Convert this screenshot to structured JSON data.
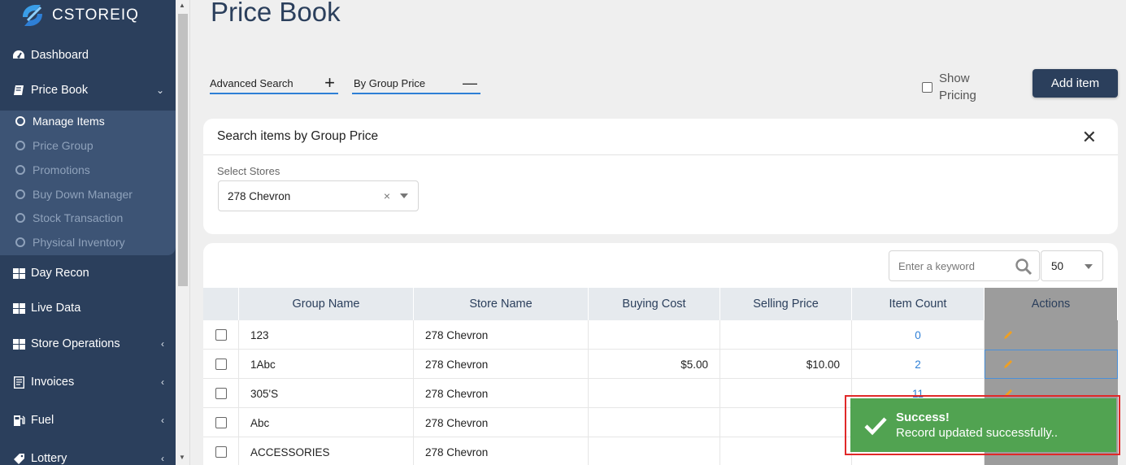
{
  "app": {
    "logo_text": "CSTOREIQ"
  },
  "sidebar": {
    "items": [
      {
        "label": "Dashboard",
        "icon": "gauge-icon"
      },
      {
        "label": "Price Book",
        "icon": "book-icon",
        "caret": "chevron-down"
      },
      {
        "label": "Day Recon",
        "icon": "grid-icon"
      },
      {
        "label": "Live Data",
        "icon": "grid-icon"
      },
      {
        "label": "Store Operations",
        "icon": "grid-icon",
        "caret": "chevron-left"
      },
      {
        "label": "Invoices",
        "icon": "invoice-icon",
        "caret": "chevron-left"
      },
      {
        "label": "Fuel",
        "icon": "fuel-icon",
        "caret": "chevron-left"
      },
      {
        "label": "Lottery",
        "icon": "tag-icon",
        "caret": "chevron-left"
      }
    ],
    "submenu": [
      {
        "label": "Manage Items",
        "active": true
      },
      {
        "label": "Price Group",
        "active": false
      },
      {
        "label": "Promotions",
        "active": false
      },
      {
        "label": "Buy Down Manager",
        "active": false
      },
      {
        "label": "Stock Transaction",
        "active": false
      },
      {
        "label": "Physical Inventory",
        "active": false
      }
    ]
  },
  "page": {
    "title": "Price Book",
    "tabs": [
      {
        "label": "Advanced Search",
        "symbol": "+"
      },
      {
        "label": "By Group Price",
        "symbol": "—"
      }
    ],
    "show_pricing_label_1": "Show",
    "show_pricing_label_2": "Pricing",
    "add_item_label": "Add item"
  },
  "search_panel": {
    "title": "Search items by Group Price",
    "stores_label": "Select Stores",
    "stores_value": "278 Chevron",
    "clear_symbol": "×"
  },
  "table": {
    "keyword_placeholder": "Enter a keyword",
    "page_size": "50",
    "columns": [
      "Group Name",
      "Store Name",
      "Buying Cost",
      "Selling Price",
      "Item Count",
      "Actions"
    ],
    "rows": [
      {
        "group": "123",
        "store": "278 Chevron",
        "buying": "",
        "selling": "",
        "count": "0"
      },
      {
        "group": "1Abc",
        "store": "278 Chevron",
        "buying": "$5.00",
        "selling": "$10.00",
        "count": "2"
      },
      {
        "group": "305'S",
        "store": "278 Chevron",
        "buying": "",
        "selling": "",
        "count": "11"
      },
      {
        "group": "Abc",
        "store": "278 Chevron",
        "buying": "",
        "selling": "",
        "count": ""
      },
      {
        "group": "ACCESSORIES",
        "store": "278 Chevron",
        "buying": "",
        "selling": "",
        "count": ""
      }
    ]
  },
  "toast": {
    "title": "Success!",
    "message": "Record updated successfully.."
  },
  "colors": {
    "sidebar": "#2b3f5c",
    "accent": "#2e7fd6",
    "success": "#51a351",
    "highlight_border": "#e02929",
    "edit_icon": "#f0a020"
  }
}
